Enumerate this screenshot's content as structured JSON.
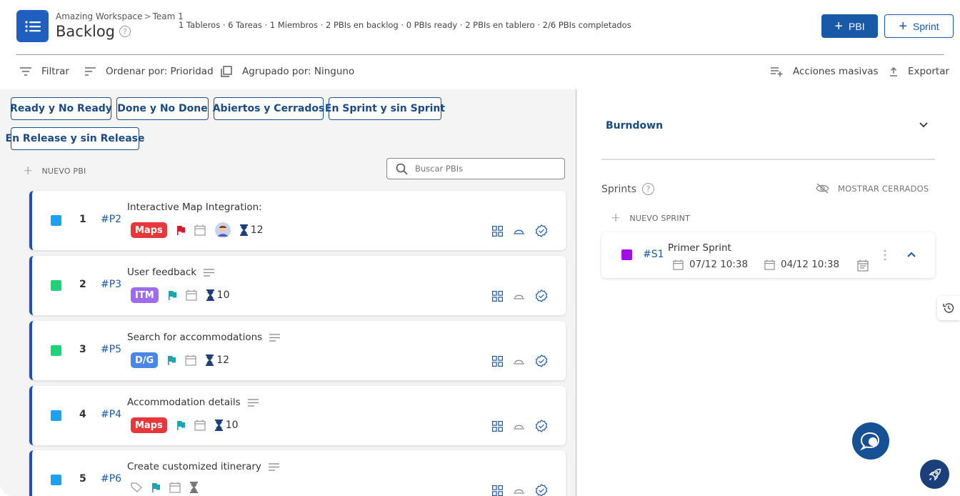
{
  "header": {
    "breadcrumb": [
      "Amazing Workspace",
      "Team 1"
    ],
    "breadcrumb_sep": ">",
    "title": "Backlog",
    "help": "?",
    "stats": "1 Tableros · 6 Tareas · 1 Miembros · 2 PBIs en backlog · 0 PBIs ready · 2 PBIs en tablero · 2/6 PBIs completados",
    "pbi_button": "PBI",
    "sprint_button": "Sprint"
  },
  "toolbar": {
    "filter": "Filtrar",
    "sort": "Ordenar por: Prioridad",
    "group": "Agrupado por: Ninguno",
    "bulk": "Acciones masivas",
    "export": "Exportar"
  },
  "filters": [
    "Ready y No Ready",
    "Done y No Done",
    "Abiertos y Cerrados",
    "En Sprint y sin Sprint",
    "En Release y sin Release"
  ],
  "backlog": {
    "new_pbi": "NUEVO PBI",
    "search_placeholder": "Buscar PBIs",
    "items": [
      {
        "num": "1",
        "code": "#P2",
        "name": "Interactive Map Integration:",
        "tag": "Maps",
        "estimate": "12",
        "color": "#1da1f2",
        "tag_color": "#e8363b",
        "flag_color": "#d41c2b"
      },
      {
        "num": "2",
        "code": "#P3",
        "name": "User feedback",
        "tag": "ITM",
        "estimate": "10",
        "color": "#1ed47a",
        "tag_color": "#9b6cf0",
        "flag_color": "#1aa6b0"
      },
      {
        "num": "3",
        "code": "#P5",
        "name": "Search for accommodations",
        "tag": "D/G",
        "estimate": "12",
        "color": "#1ed47a",
        "tag_color": "#4a86e8",
        "flag_color": "#1aa6b0"
      },
      {
        "num": "4",
        "code": "#P4",
        "name": "Accommodation details",
        "tag": "Maps",
        "estimate": "10",
        "color": "#1da1f2",
        "tag_color": "#e8363b",
        "flag_color": "#1aa6b0"
      },
      {
        "num": "5",
        "code": "#P6",
        "name": "Create customized itinerary",
        "tag": "",
        "estimate": "",
        "color": "#1da1f2",
        "tag_color": "",
        "flag_color": "#1aa6b0"
      }
    ]
  },
  "right": {
    "burndown": "Burndown",
    "sprints_label": "Sprints",
    "show_closed": "MOSTRAR CERRADOS",
    "new_sprint": "NUEVO SPRINT",
    "sprint": {
      "code": "#S1",
      "name": "Primer Sprint",
      "start": "07/12 10:38",
      "end": "04/12 10:38"
    }
  }
}
